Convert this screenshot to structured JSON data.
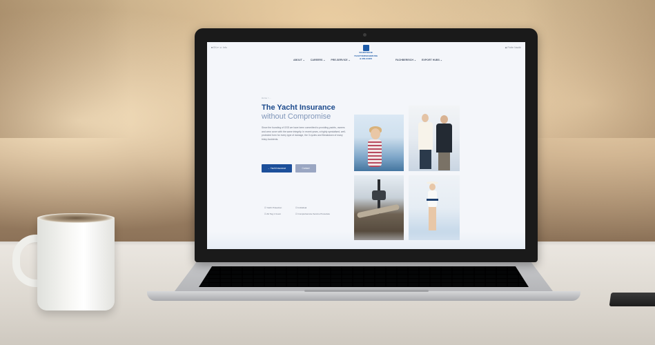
{
  "site": {
    "topbar_left": "■ EN ▾   ☏ Info",
    "topbar_right": "◆ Flotte Nautik",
    "logo_text_line1": "SCHIFFSHUB",
    "logo_text_line2": "YACHTVERSICHERUNG",
    "logo_text_line3": "& ANLAGEN",
    "nav": [
      {
        "label": "ABOUT ⌄"
      },
      {
        "label": "CAREERS ⌄"
      },
      {
        "label": "PRE-SERVICE ⌄"
      }
    ],
    "nav_right": [
      {
        "label": "FACHBEREICH ⌄"
      },
      {
        "label": "EXPORT HUBS ⌄"
      }
    ],
    "hero": {
      "eyebrow": "Home > ...",
      "title": "The Yacht Insurance",
      "subtitle": "without Compromise",
      "body": "Since the founding of GSS we have been committed to providing yachts, owners and crew cover with the same integrity. In recent years, a highly specialised, well-protected form for every type of damage, the 3 cycles and Breakdown of many tricky Accidents.",
      "primary_button": "→ Yacht insurance",
      "secondary_button": "Contact"
    },
    "features": [
      "☑ Yacht Protection",
      "☑ Individual",
      "☑ Ab Tag 1 Cover",
      "☑ Comprehensive Service Procedure"
    ]
  },
  "colors": {
    "brand": "#1c4a8c",
    "accent": "#7f95b8"
  }
}
